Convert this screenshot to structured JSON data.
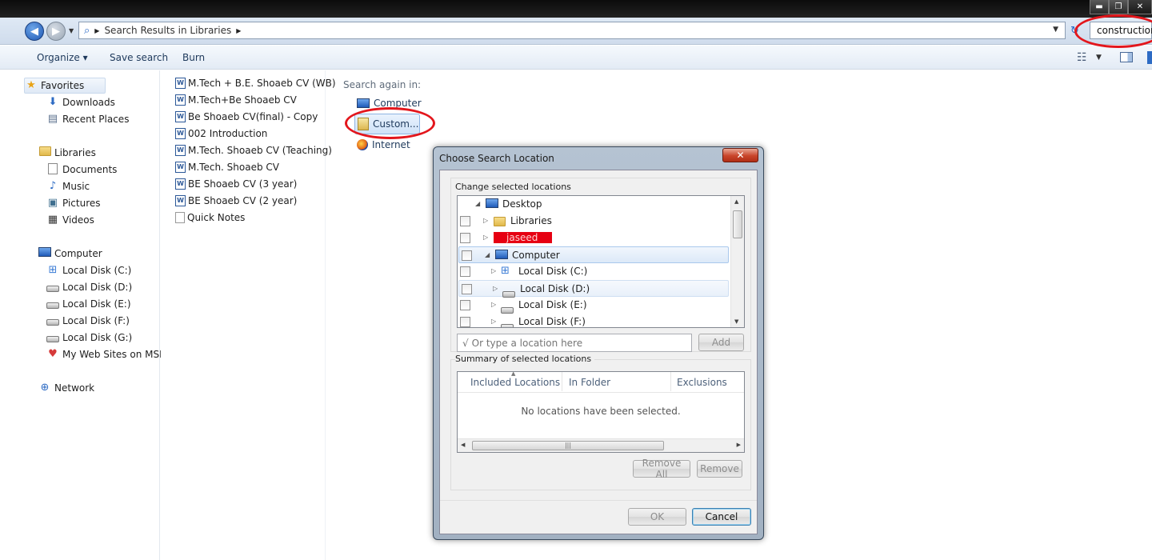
{
  "window": {
    "controls": {
      "minimize": "▬",
      "maximize": "❐",
      "close": "✕"
    }
  },
  "address_bar": {
    "path": "Search Results in Libraries",
    "search_value": "construction"
  },
  "command_bar": {
    "organize": "Organize ▾",
    "save_search": "Save search",
    "burn": "Burn"
  },
  "navigation": {
    "favorites": {
      "label": "Favorites",
      "items": [
        "Downloads",
        "Recent Places"
      ]
    },
    "libraries": {
      "label": "Libraries",
      "items": [
        "Documents",
        "Music",
        "Pictures",
        "Videos"
      ]
    },
    "computer": {
      "label": "Computer",
      "items": [
        "Local Disk (C:)",
        "Local Disk (D:)",
        "Local Disk (E:)",
        "Local Disk (F:)",
        "Local Disk (G:)",
        "My Web Sites on MSN"
      ]
    },
    "network": {
      "label": "Network"
    }
  },
  "results": {
    "files": [
      {
        "name": "M.Tech + B.E. Shoaeb CV (WB)",
        "icon": "word-doc-icon"
      },
      {
        "name": "M.Tech+Be Shoaeb CV",
        "icon": "word-doc-icon"
      },
      {
        "name": "Be Shoaeb CV(final) - Copy",
        "icon": "word-doc-icon"
      },
      {
        "name": "002 Introduction",
        "icon": "word-doc-icon"
      },
      {
        "name": "M.Tech. Shoaeb CV (Teaching)",
        "icon": "word-doc-icon"
      },
      {
        "name": "M.Tech. Shoaeb CV",
        "icon": "word-doc-icon"
      },
      {
        "name": "BE Shoaeb CV (3 year)",
        "icon": "word-doc-icon"
      },
      {
        "name": "BE Shoaeb CV (2 year)",
        "icon": "word-doc-icon"
      },
      {
        "name": "Quick Notes",
        "icon": "note-icon"
      }
    ]
  },
  "search_again": {
    "title": "Search again in:",
    "computer": "Computer",
    "custom": "Custom...",
    "internet": "Internet"
  },
  "dialog": {
    "title": "Choose Search Location",
    "close": "✕",
    "change_group": "Change selected locations",
    "tree": {
      "desktop": "Desktop",
      "libraries": "Libraries",
      "user": "jaseed",
      "computer": "Computer",
      "disk_c": "Local Disk (C:)",
      "disk_d": "Local Disk (D:)",
      "disk_e": "Local Disk (E:)",
      "disk_f": "Local Disk (F:)"
    },
    "location_placeholder": "Or type a location here",
    "add": "Add",
    "summary_group": "Summary of selected locations",
    "columns": [
      "Included Locations",
      "In Folder",
      "Exclusions"
    ],
    "empty_message": "No locations have been selected.",
    "remove_all": "Remove All",
    "remove": "Remove",
    "ok": "OK",
    "cancel": "Cancel"
  },
  "colors": {
    "annotation": "#e3161c",
    "redaction": "#e60012",
    "accent": "#1d56b3"
  }
}
